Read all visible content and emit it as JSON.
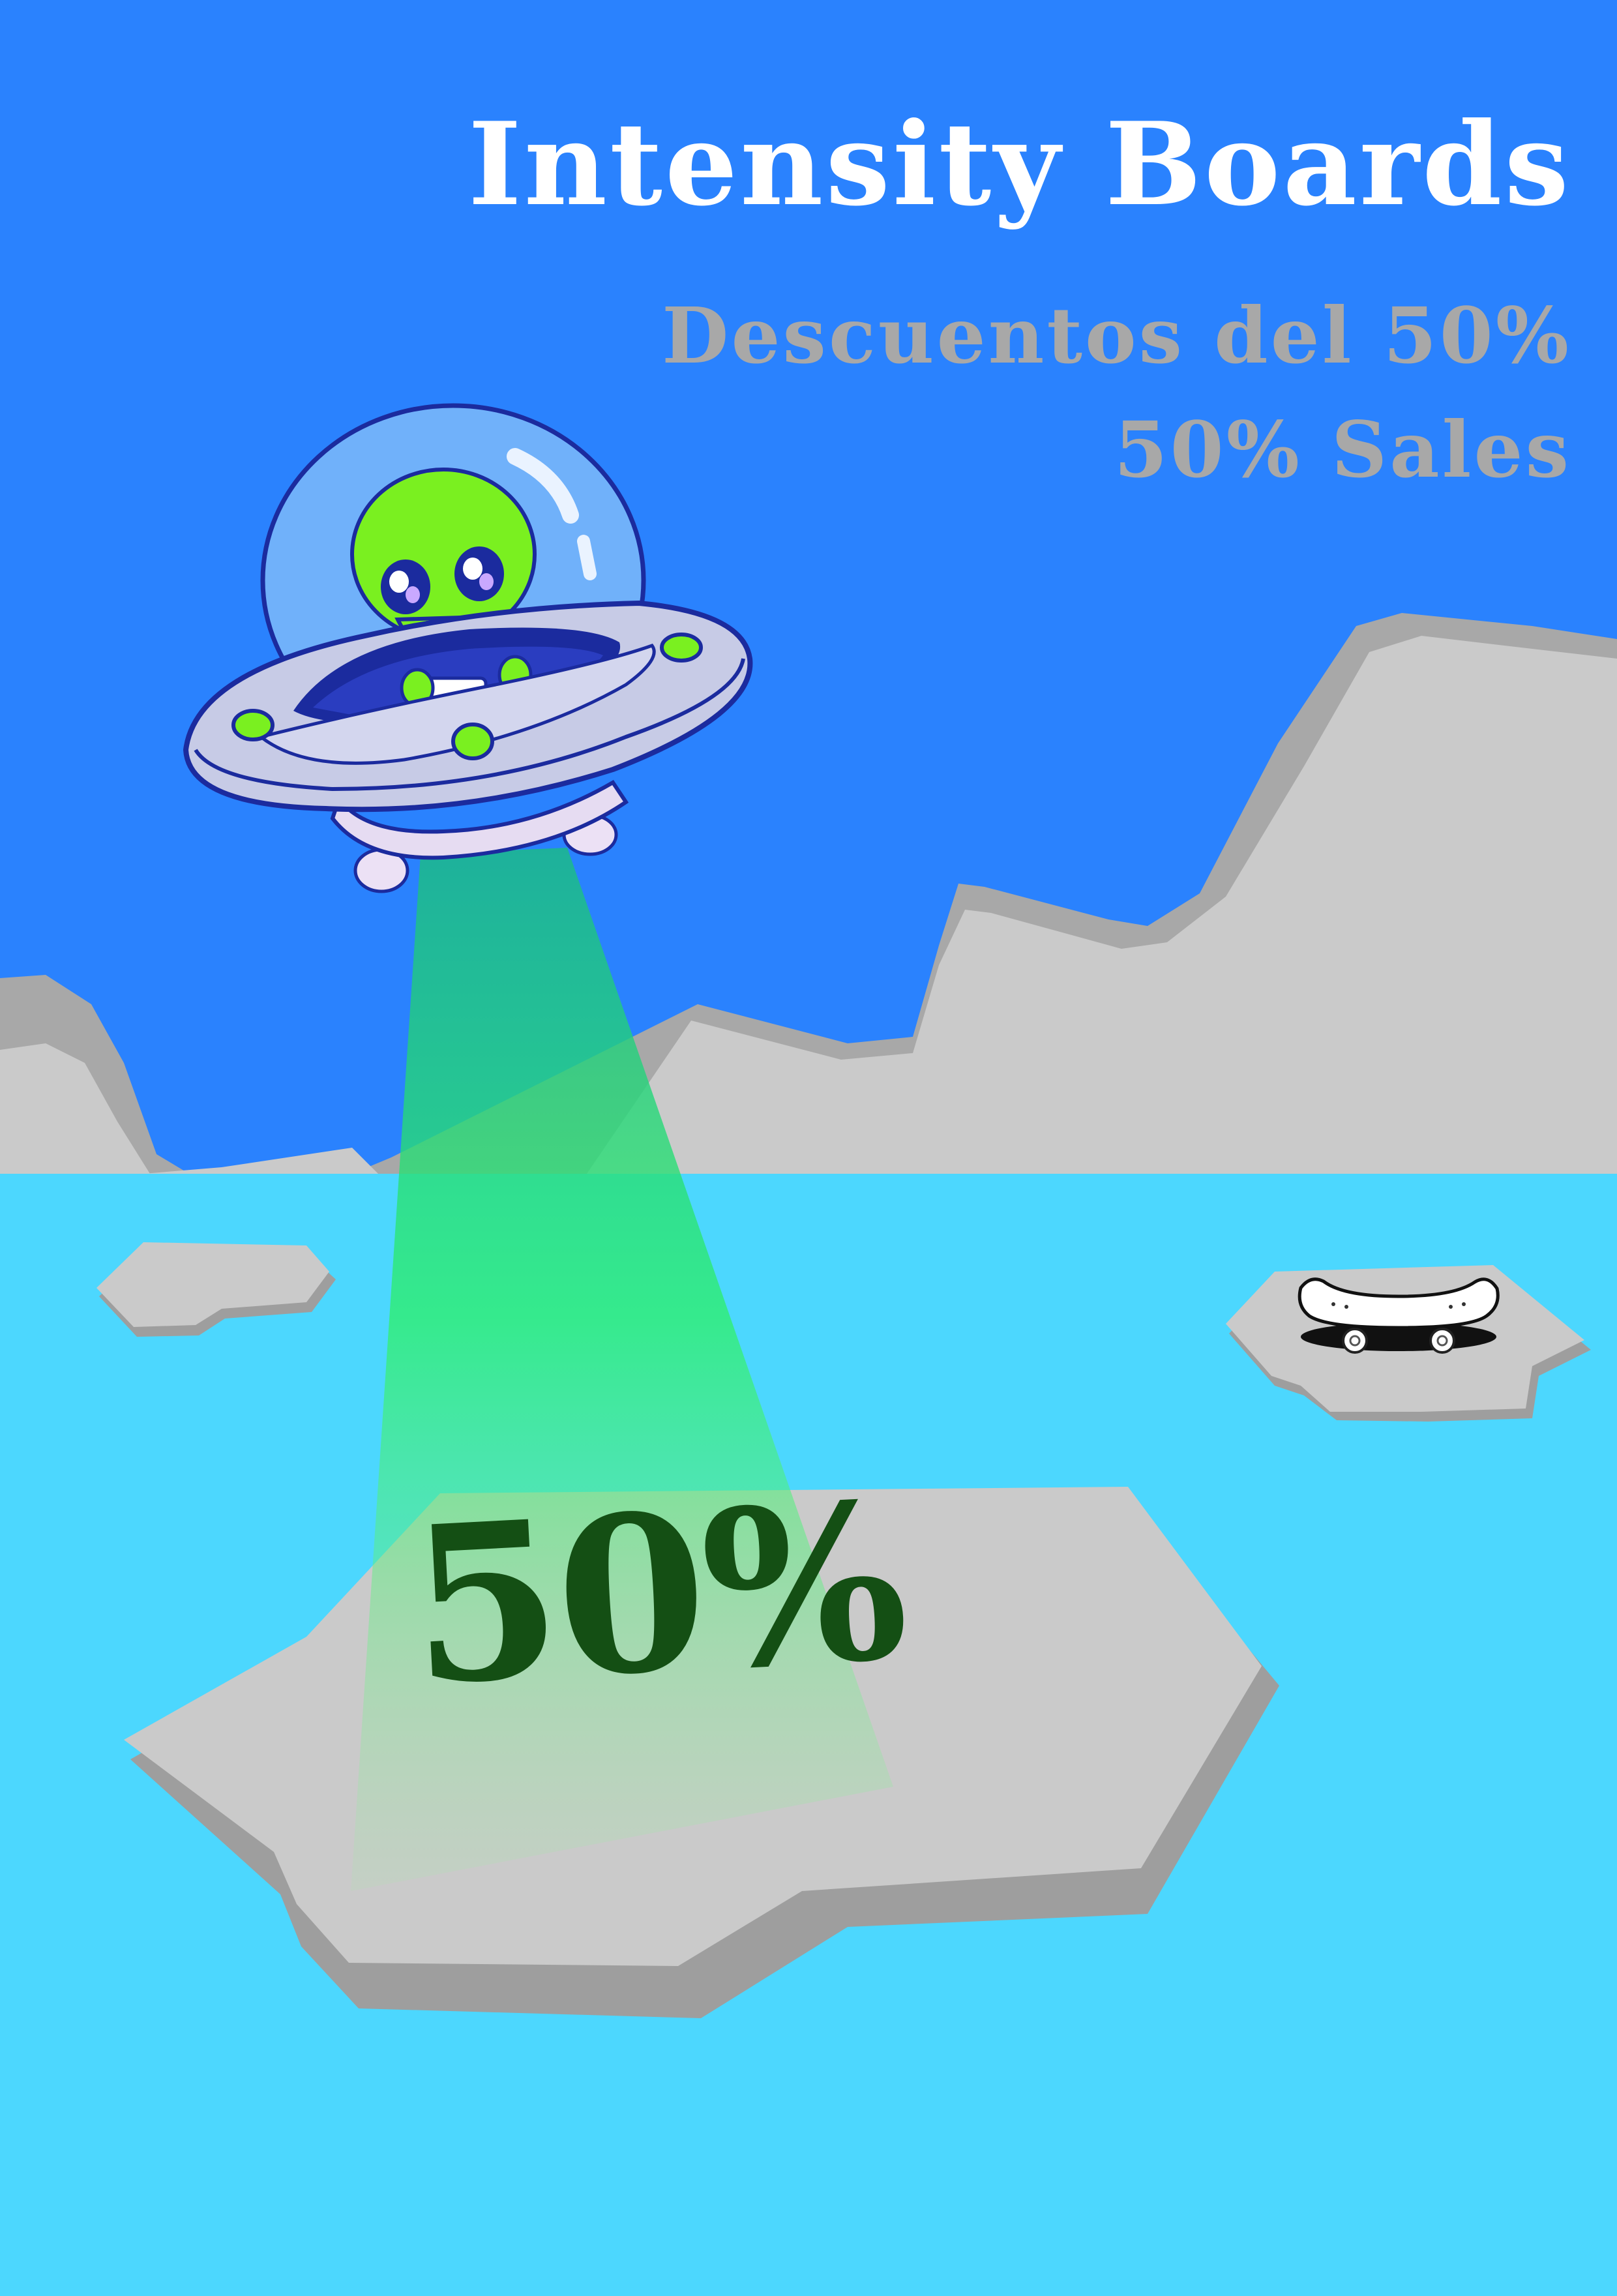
{
  "poster": {
    "title": "Intensity Boards",
    "subtitle_es": "Descuentos del 50%",
    "subtitle_en": "50% Sales",
    "badge": "50%"
  },
  "icons": {
    "ufo": "ufo-alien-icon",
    "skateboard": "skateboard-icon"
  },
  "colors": {
    "sky": "#2a82fe",
    "water": "#4cd7fe",
    "ice": "#cccccc",
    "ice_shadow": "#9e9e9e",
    "beam": "#2bee63",
    "title": "#ffffff",
    "subtitle": "#a8a8a8",
    "badge": "#144f14",
    "alien": "#7af020"
  }
}
